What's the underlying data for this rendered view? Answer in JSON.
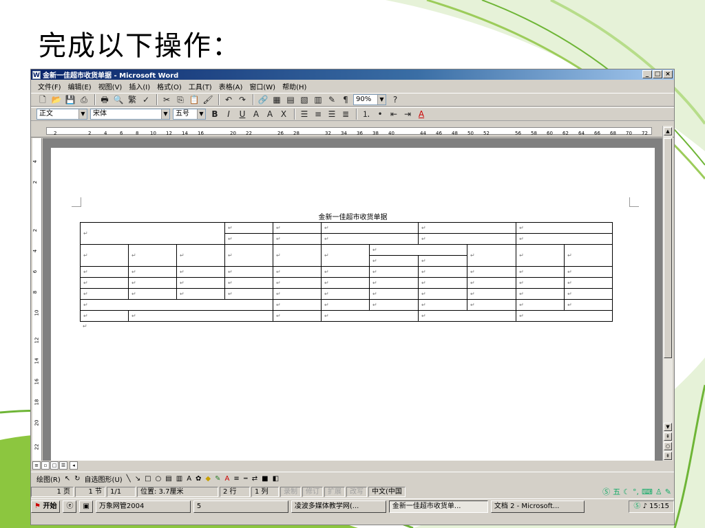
{
  "slide": {
    "title": "完成以下操作："
  },
  "window": {
    "title": "金新一佳超市收货单据 - Microsoft Word",
    "controls": [
      "_",
      "□",
      "×"
    ]
  },
  "menu": [
    "文件(F)",
    "编辑(E)",
    "视图(V)",
    "插入(I)",
    "格式(O)",
    "工具(T)",
    "表格(A)",
    "窗口(W)",
    "帮助(H)"
  ],
  "toolbar": {
    "zoom": "90%",
    "style": "正文",
    "font": "宋体",
    "size": "五号"
  },
  "ruler": {
    "numbers": [
      "2",
      "2",
      "4",
      "6",
      "8",
      "10",
      "12",
      "14",
      "16",
      "20",
      "22",
      "26",
      "28",
      "32",
      "34",
      "36",
      "38",
      "40",
      "44",
      "46",
      "48",
      "50",
      "52",
      "56",
      "58",
      "60",
      "62",
      "64",
      "66",
      "68",
      "70",
      "72"
    ]
  },
  "vruler": {
    "numbers": [
      "4",
      "2",
      "2",
      "4",
      "6",
      "8",
      "10",
      "12",
      "14",
      "16",
      "18",
      "20",
      "22"
    ]
  },
  "document": {
    "heading": "金新一佳超市收货单据",
    "cell_mark": "↵"
  },
  "drawbar": {
    "draw": "绘图(R)",
    "autoshapes": "自选图形(U)"
  },
  "status": {
    "page": "1 页",
    "section": "1 节",
    "pages": "1/1",
    "position": "位置: 3.7厘米",
    "line": "2 行",
    "column": "1 列",
    "rec": "录制",
    "trk": "修订",
    "ext": "扩展",
    "ovr": "改写",
    "lang": "中文(中国"
  },
  "taskbar": {
    "start": "开始",
    "tasks": [
      "万象网管2004",
      "5",
      "凌波多媒体教学网(...",
      "金新一佳超市收货单...",
      "文档 2 - Microsoft..."
    ],
    "clock": "15:15"
  },
  "ime": {
    "label": "五"
  }
}
